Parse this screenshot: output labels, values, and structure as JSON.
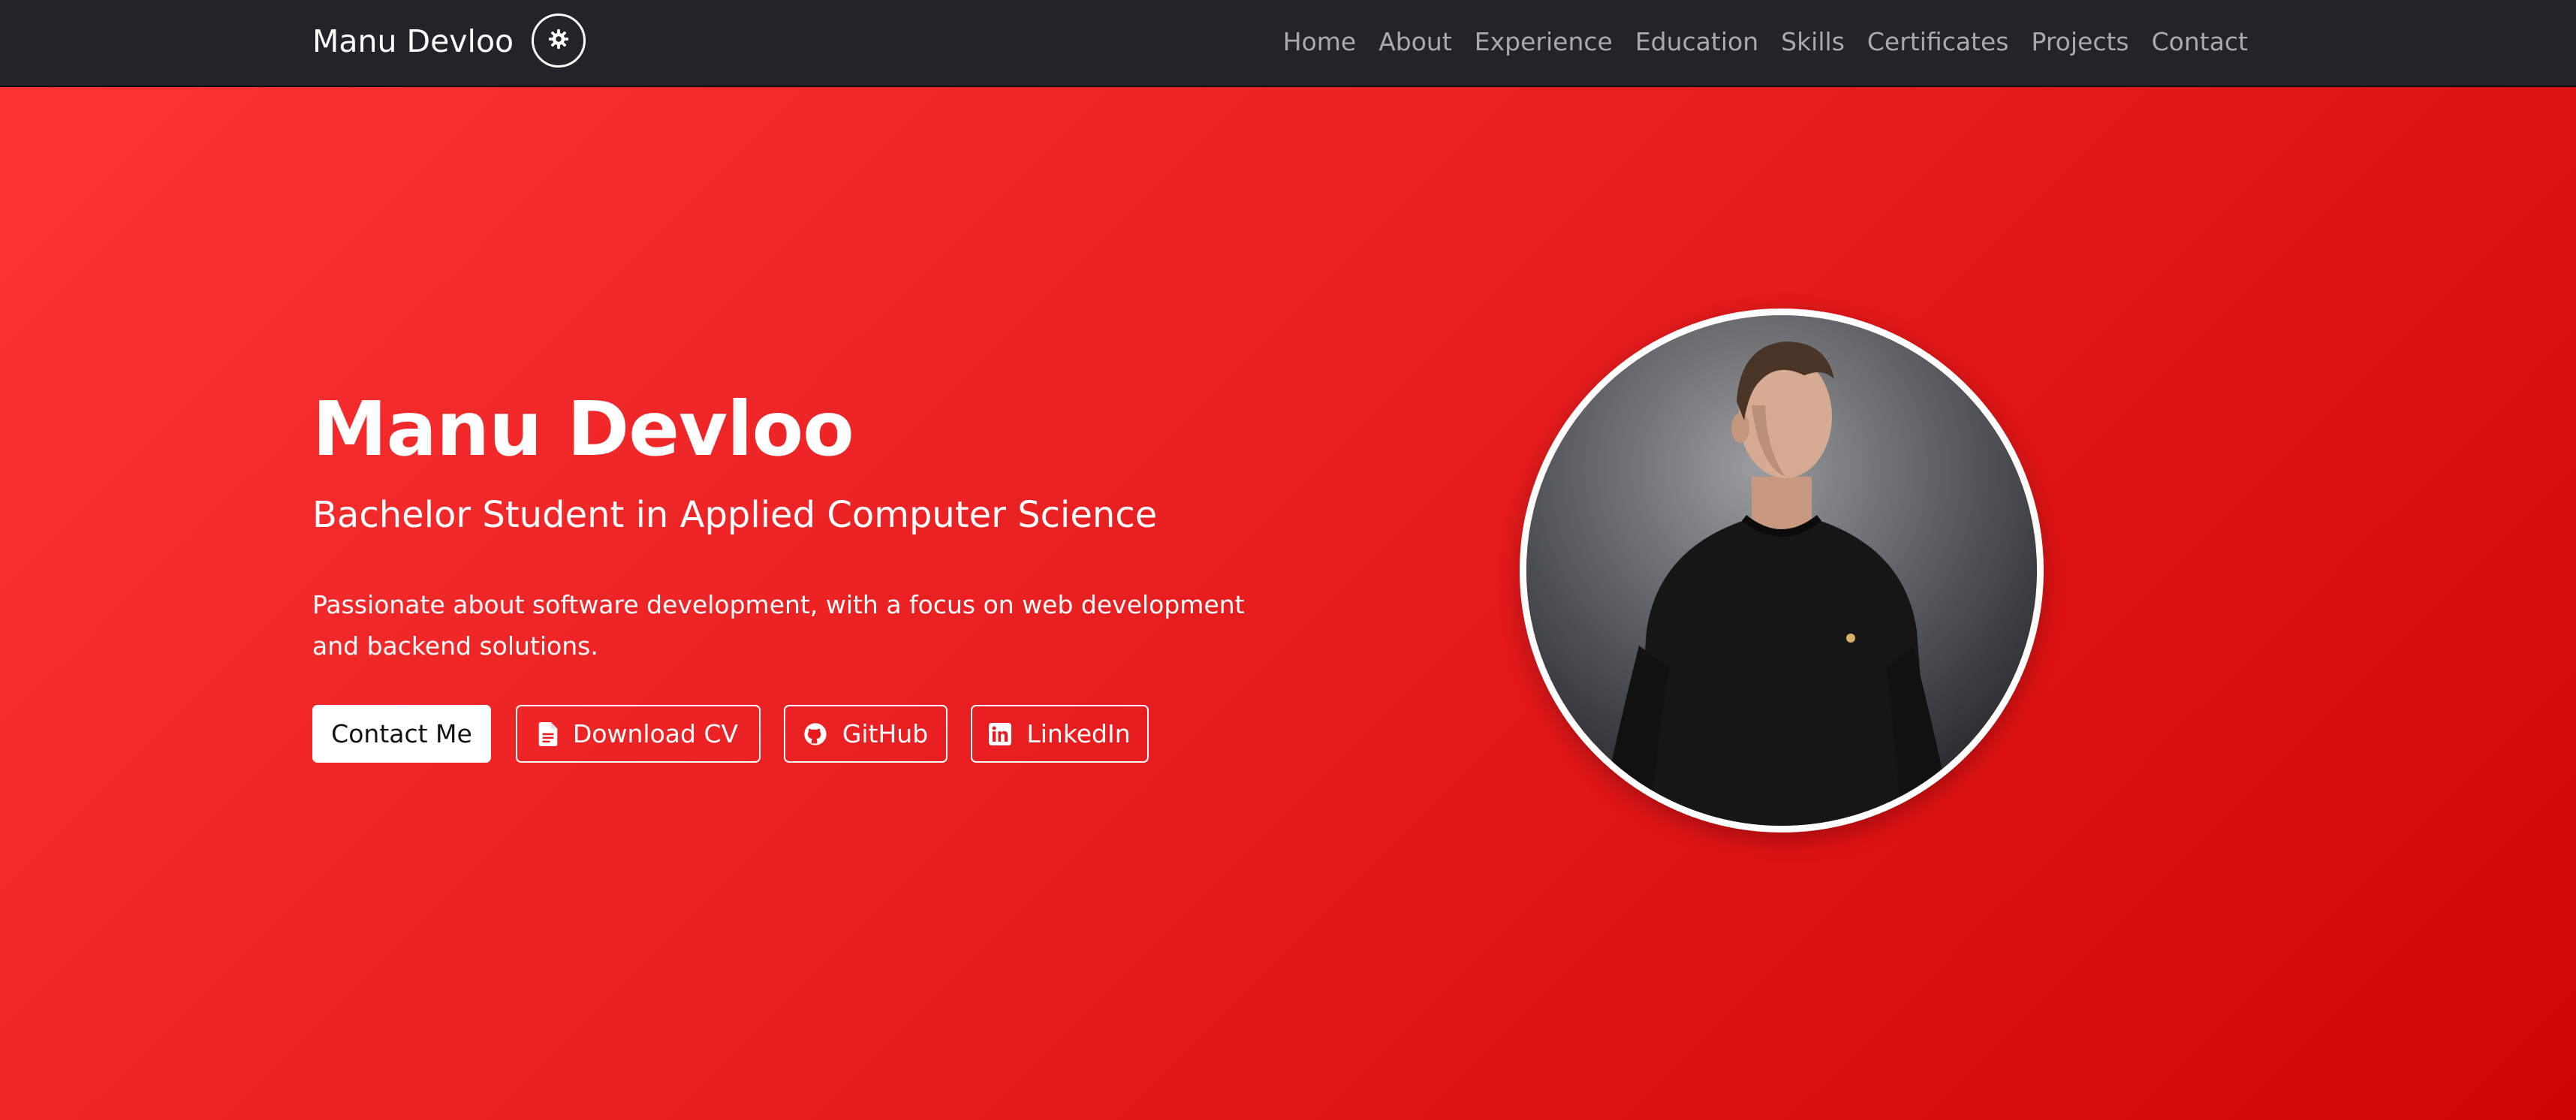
{
  "nav": {
    "brand": "Manu Devloo",
    "theme_icon": "gear-icon",
    "links": [
      "Home",
      "About",
      "Experience",
      "Education",
      "Skills",
      "Certificates",
      "Projects",
      "Contact"
    ]
  },
  "hero": {
    "name": "Manu Devloo",
    "subtitle": "Bachelor Student in Applied Computer Science",
    "description": "Passionate about software development, with a focus on web development and backend solutions.",
    "buttons": {
      "contact": "Contact Me",
      "cv": "Download CV",
      "cv_icon": "file-icon",
      "github": "GitHub",
      "github_icon": "github-icon",
      "linkedin": "LinkedIn",
      "linkedin_icon": "linkedin-icon"
    },
    "portrait_alt": "Profile photo"
  },
  "colors": {
    "navbar": "#212529",
    "hero_start": "#fc3434",
    "hero_end": "#cf0404",
    "text": "#ffffff"
  }
}
